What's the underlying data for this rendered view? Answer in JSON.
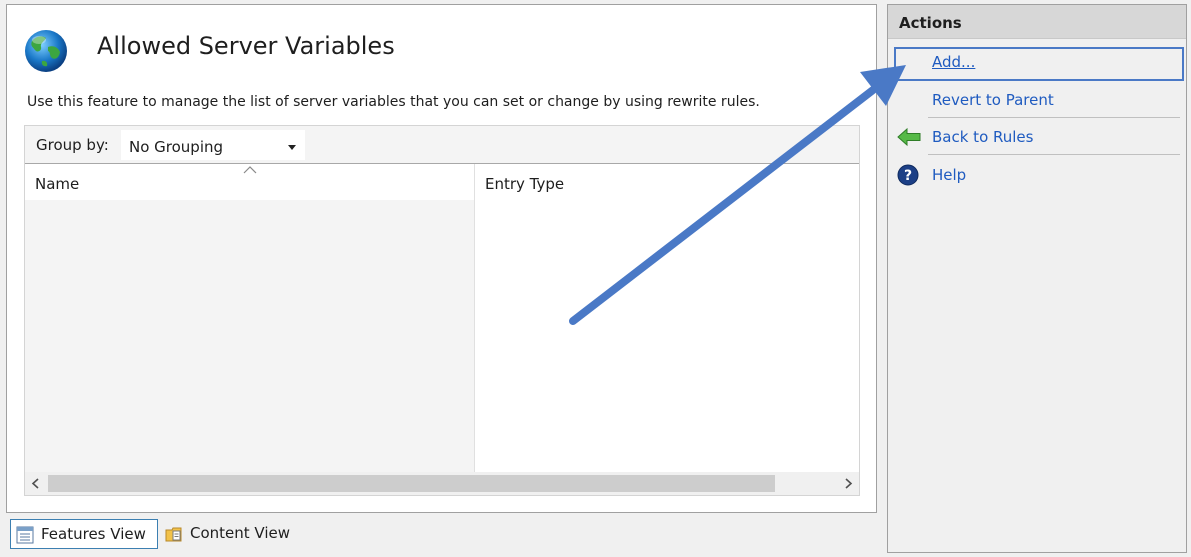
{
  "feature": {
    "title": "Allowed Server Variables",
    "description": "Use this feature to manage the list of server variables that you can set or change by using rewrite rules.",
    "icon": "globe-icon"
  },
  "list": {
    "group_by_label": "Group by:",
    "group_by_value": "No Grouping",
    "columns": [
      "Name",
      "Entry Type"
    ],
    "sort_column": "Name",
    "rows": []
  },
  "view_tabs": [
    {
      "label": "Features View",
      "icon": "features-view-icon",
      "selected": true
    },
    {
      "label": "Content View",
      "icon": "content-view-icon",
      "selected": false
    }
  ],
  "actions": {
    "title": "Actions",
    "items": [
      {
        "label": "Add...",
        "icon": "",
        "highlighted": true
      },
      {
        "label": "Revert to Parent",
        "icon": ""
      },
      {
        "label": "Back to Rules",
        "icon": "green-back-arrow-icon"
      },
      {
        "label": "Help",
        "icon": "help-icon"
      }
    ]
  },
  "annotation": {
    "type": "arrow",
    "points_to": "Add...",
    "color": "#4a79c6"
  },
  "colors": {
    "link": "#1f5bc0",
    "accent": "#4a79c6",
    "actions_header": "#d7d7d7"
  }
}
